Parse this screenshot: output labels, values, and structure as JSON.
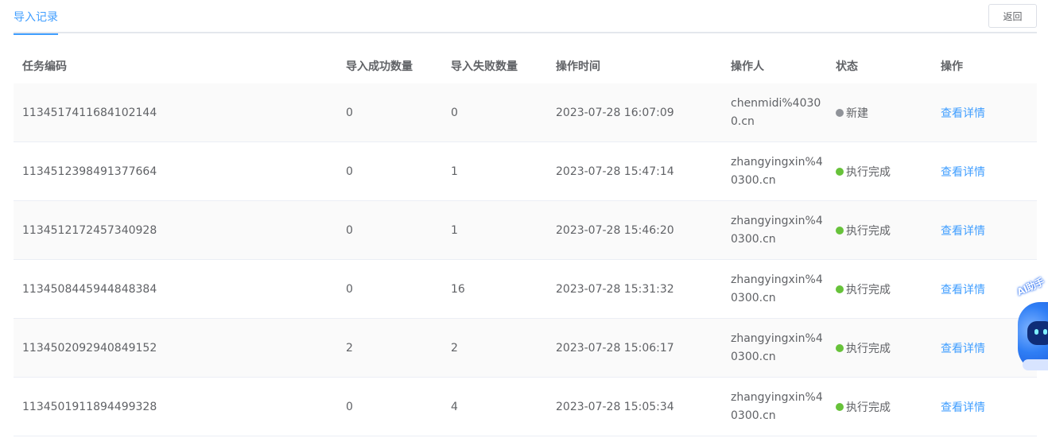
{
  "header": {
    "active_tab": "导入记录",
    "back_label": "返回"
  },
  "table": {
    "columns": [
      "任务编码",
      "导入成功数量",
      "导入失败数量",
      "操作时间",
      "操作人",
      "状态",
      "操作"
    ],
    "rows": [
      {
        "task_code": "1134517411684102144",
        "success": "0",
        "failed": "0",
        "time": "2023-07-28 16:07:09",
        "operator": "chenmidi%40300.cn",
        "status": "新建",
        "status_color": "#909399",
        "action": "查看详情"
      },
      {
        "task_code": "1134512398491377664",
        "success": "0",
        "failed": "1",
        "time": "2023-07-28 15:47:14",
        "operator": "zhangyingxin%40300.cn",
        "status": "执行完成",
        "status_color": "#67c23a",
        "action": "查看详情"
      },
      {
        "task_code": "1134512172457340928",
        "success": "0",
        "failed": "1",
        "time": "2023-07-28 15:46:20",
        "operator": "zhangyingxin%40300.cn",
        "status": "执行完成",
        "status_color": "#67c23a",
        "action": "查看详情"
      },
      {
        "task_code": "1134508445944848384",
        "success": "0",
        "failed": "16",
        "time": "2023-07-28 15:31:32",
        "operator": "zhangyingxin%40300.cn",
        "status": "执行完成",
        "status_color": "#67c23a",
        "action": "查看详情"
      },
      {
        "task_code": "1134502092940849152",
        "success": "2",
        "failed": "2",
        "time": "2023-07-28 15:06:17",
        "operator": "zhangyingxin%40300.cn",
        "status": "执行完成",
        "status_color": "#67c23a",
        "action": "查看详情"
      },
      {
        "task_code": "1134501911894499328",
        "success": "0",
        "failed": "4",
        "time": "2023-07-28 15:05:34",
        "operator": "zhangyingxin%40300.cn",
        "status": "执行完成",
        "status_color": "#67c23a",
        "action": "查看详情"
      }
    ]
  },
  "ai_helper": {
    "label": "AI助手",
    "icon": "robot-assistant-icon"
  },
  "colors": {
    "accent": "#409eff",
    "success": "#67c23a",
    "neutral": "#909399"
  }
}
